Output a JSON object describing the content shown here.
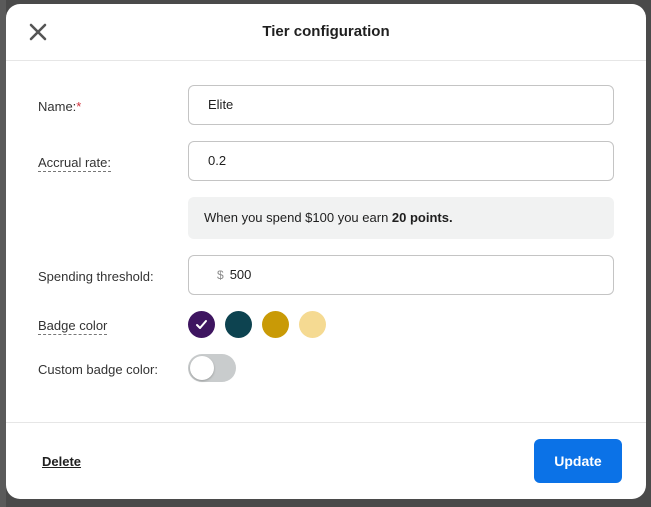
{
  "modal": {
    "title": "Tier configuration"
  },
  "form": {
    "name_label": "Name:",
    "name_required_mark": "*",
    "name_value": "Elite",
    "accrual_label": "Accrual rate:",
    "accrual_value": "0.2",
    "info_text": "When you spend $100 you earn ",
    "info_bold": "20 points.",
    "threshold_label": "Spending threshold:",
    "threshold_prefix": "$",
    "threshold_value": "500",
    "badge_label": "Badge color",
    "badge_colors": [
      "#3e1560",
      "#0d4350",
      "#c99a06",
      "#f5da92"
    ],
    "badge_selected_index": 0,
    "custom_badge_label": "Custom badge color:",
    "custom_badge_enabled": false
  },
  "footer": {
    "delete_label": "Delete",
    "update_label": "Update"
  },
  "colors": {
    "primary": "#0b72e7",
    "required": "#d0303a"
  }
}
